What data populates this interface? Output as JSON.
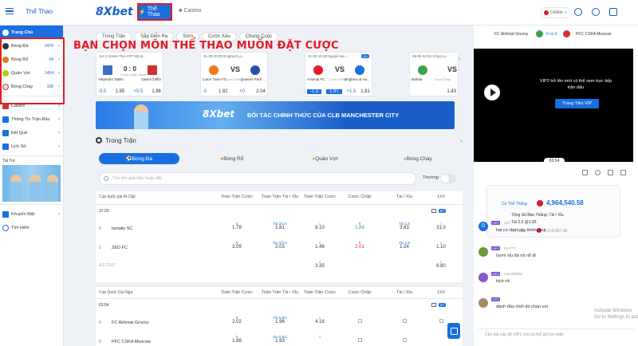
{
  "topbar": {
    "sport_title": "Thể Thao",
    "logo": "8Xbet",
    "tab_sport": "Thể Thao",
    "tab_casino": "Casino",
    "balance": "0 Điểm"
  },
  "sidebar": {
    "items": [
      {
        "label": "Trang Chủ",
        "count": ""
      },
      {
        "label": "Bóng Đá",
        "count": "2470"
      },
      {
        "label": "Bóng Rổ",
        "count": "64"
      },
      {
        "label": "Quần Vợt",
        "count": "1454"
      },
      {
        "label": "Bóng Chày",
        "count": "158"
      },
      {
        "label": "Casino",
        "count": ""
      },
      {
        "label": "Thông Tin Trận Đấu",
        "count": ""
      },
      {
        "label": "Kết Quả",
        "count": ""
      },
      {
        "label": "Lịch Sử",
        "count": ""
      }
    ],
    "sponsor_label": "Tài Trợ",
    "bottom_items": [
      {
        "label": "Khuyến Mãi"
      },
      {
        "label": "Tìm kiếm"
      }
    ]
  },
  "annotation": "BẠN CHỌN MÔN THỂ THAO MUỐN ĐẶT CƯỢC",
  "filter_tabs": [
    "Trong Trận",
    "Sắp Diễn Ra",
    "Sớm",
    "Cược Xâu",
    "Chung Cuộc"
  ],
  "match_cards": [
    {
      "head": "Set 1 Game Thứ ATP Mỹ M...",
      "team_a": "Alejandro Tabilo",
      "team_b": "David Goffin",
      "score": "0 : 0",
      "mid": "Cược Chấp Game",
      "odds": [
        "-5.5",
        "1.85",
        "+5.5",
        "1.86"
      ],
      "badge": ""
    },
    {
      "head": "31-08 03:00  England Le...",
      "team_a": "Luton Town FC",
      "team_b": "Queens Park ...",
      "score": "VS",
      "mid": "Cược Chấp",
      "odds": [
        "-0",
        "1.82",
        "+0",
        "2.04"
      ],
      "badge": ""
    },
    {
      "head": "31-08 19:30  Ngoại Hạn...",
      "team_a": "Arsenal FC",
      "team_b": "Brighton & Ho...",
      "score": "VS",
      "mid": "Cược Chấp",
      "odds": [
        "-1.5",
        "1.97",
        "+1.5",
        "1.81"
      ],
      "badge": "111"
    },
    {
      "head": "08-09 04:00  Vòng Lo...",
      "team_a": "Bolivia",
      "team_b": "",
      "score": "VS",
      "mid": "Cược Chấp",
      "odds": [
        "",
        "",
        "",
        "1.43"
      ],
      "badge": ""
    }
  ],
  "promo": {
    "logo": "8Xbet",
    "text": "ĐỐI TÁC CHÍNH THỨC CỦA CLB MANCHESTER CITY"
  },
  "live_title": "Trong Trận",
  "sport_tabs": [
    "Bóng Đá",
    "Bóng Rổ",
    "Quần Vợt",
    "Bóng Chày"
  ],
  "search": {
    "placeholder": "Tìm tên giải đấu hoặc đội",
    "toggle_label": "Thường"
  },
  "table": {
    "league1": "Cúp quốc gia Ai Cập",
    "league2": "Cúp Quốc Gia Nga",
    "headers": [
      "Toàn Trận Cược",
      "Toàn Trận Tài / Xỉu",
      "Toàn Trận Cược",
      "Cược Chấp",
      "Tài / Xỉu",
      "1X2"
    ],
    "m1_time": "37:20",
    "m1_badge": "57",
    "m1_team_a": "Ismaily SC",
    "m1_team_b": "ZED FC",
    "m1_score_a": "0",
    "m1_score_b": "1",
    "m1_row_a": [
      [
        "0",
        "1.78"
      ],
      [
        "Tài 2/2.5",
        "1.81"
      ],
      [
        "1",
        "8.10"
      ],
      [
        "0",
        "1.88"
      ],
      [
        "Tài 1.5",
        "3.63"
      ],
      [
        "1",
        "31.0"
      ]
    ],
    "m1_row_b": [
      [
        "0",
        "2.09"
      ],
      [
        "Xỉu 2/2.5",
        "2.03"
      ],
      [
        "2",
        "1.48"
      ],
      [
        "0",
        "2.01"
      ],
      [
        "Xỉu 1.5",
        "1.24"
      ],
      [
        "2",
        "1.10"
      ]
    ],
    "m1_row_c": [
      [
        "X",
        "3.35"
      ],
      [
        "X",
        "6.80"
      ]
    ],
    "m1_foot": "0-1   2 0-0",
    "m2_time": "63:54",
    "m2_badge": "27",
    "m2_team_a": "FC Akhmat Grozny",
    "m2_team_b": "PFC CSKA Moscow",
    "m2_score_a": "0",
    "m2_score_b": "0",
    "m2_row_a": [
      [
        "0",
        "2.02"
      ],
      [
        "Tài 0.5/1",
        "1.96"
      ],
      [
        "1",
        "4.18"
      ]
    ],
    "m2_row_b": [
      [
        "0",
        "1.88"
      ],
      [
        "Xỉu 0.5/1",
        "1.93"
      ],
      [
        "2",
        ""
      ]
    ]
  },
  "right": {
    "team_a": "FC Akhmat Grozny",
    "team_b": "PFC CSKA Moscow",
    "score": "0 vs 0",
    "vip_msg": "VIP2 trở lên mới có thể xem trực tiếp trận đấu",
    "vip_btn": "Trang Tâm VIP",
    "video_time": "63:54",
    "jackpot_label": "Có Thể Thắng",
    "jackpot_value": "4,964,540.58",
    "jackpot_line1": "Tổng Số Bàn Thắng: Tài / Xỉu",
    "jackpot_line2": "Tài 2.5 @1.95",
    "jackpot_line3": "Đã Cược",
    "jackpot_value2": "5,014,687.48",
    "chats": [
      {
        "name": "A47",
        "text": "hai cu chơi vậy không vui"
      },
      {
        "name": "ISAT***",
        "text": "Gơm xỉu đá rôi nổ đi"
      },
      {
        "name": "macadhebe",
        "text": "kịch rồi"
      },
      {
        "name": "",
        "text": "đánh đầu chết đó chán vơi"
      }
    ],
    "chat_placeholder": "Cần đạt cấp độ VIP1 mới có thể gửi tin nhắn",
    "watermark": "Activate Windows\nGo to Settings to activate Windows."
  },
  "colors": {
    "brand": "#1a6fe0",
    "accent_red": "#e31b23"
  }
}
